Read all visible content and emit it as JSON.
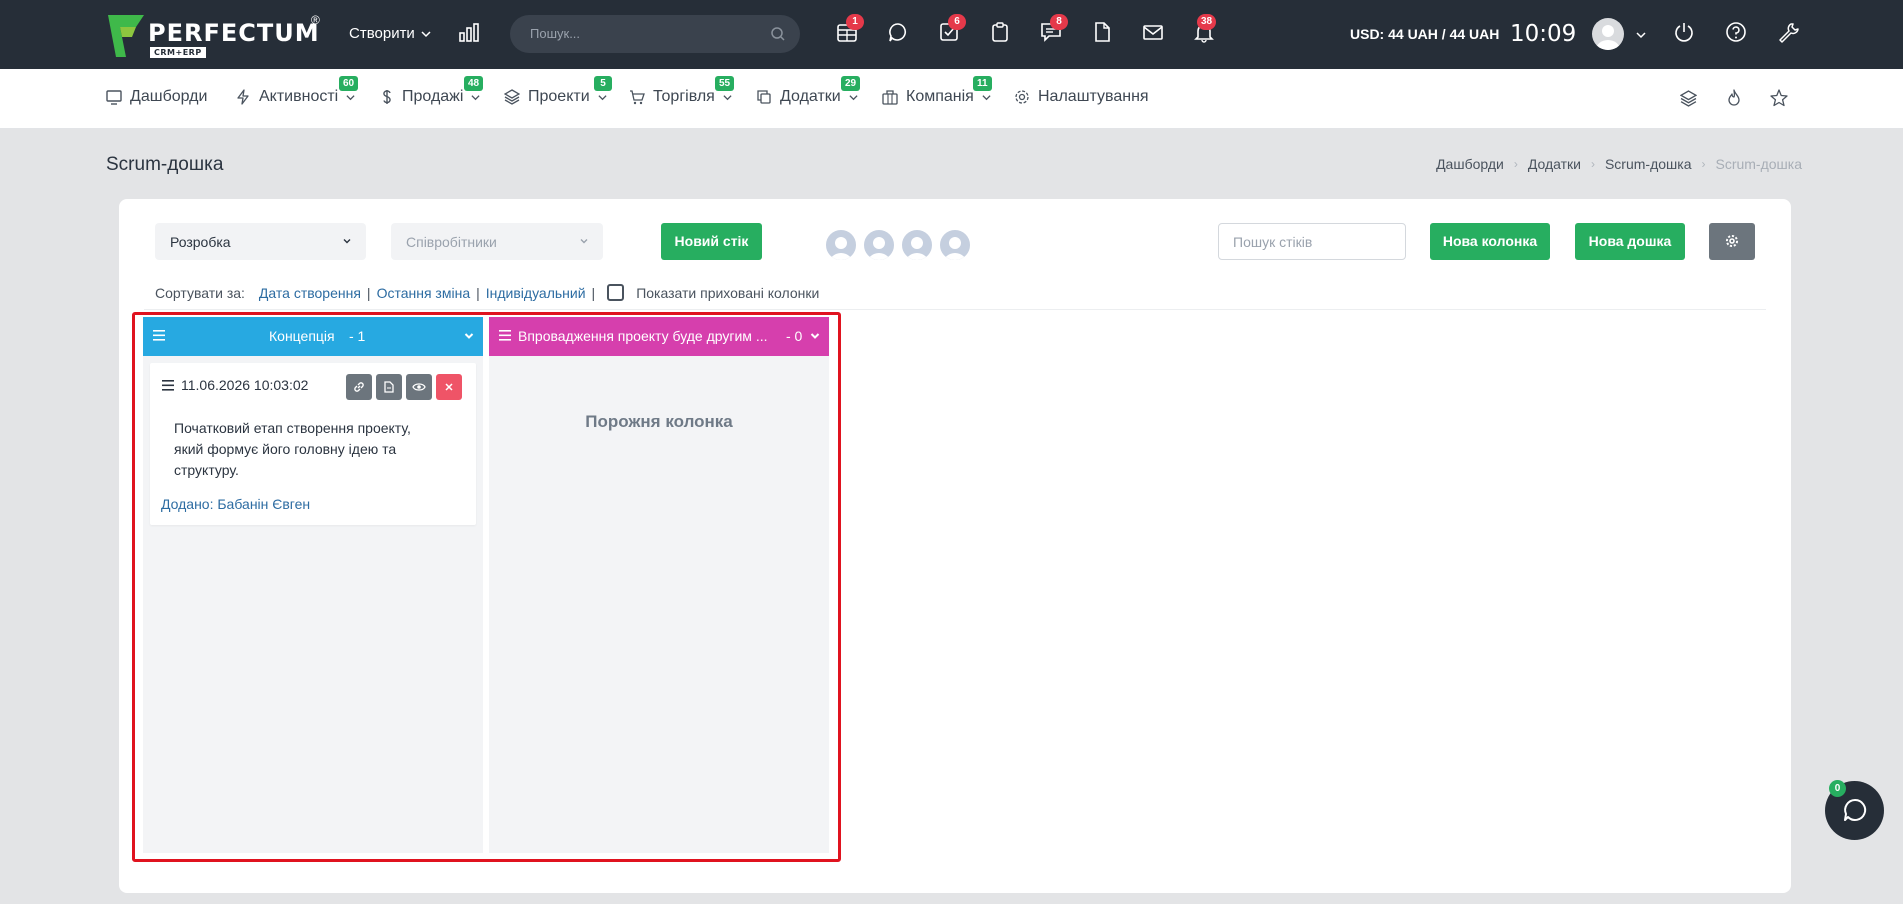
{
  "topbar": {
    "logo_text": "PERFECTUM",
    "logo_sub": "CRM+ERP",
    "logo_reg": "®",
    "create_label": "Створити",
    "search_placeholder": "Пошук...",
    "badges": {
      "calendar": "1",
      "tasks": "6",
      "chat": "8",
      "notifications": "38"
    },
    "currency": "USD: 44 UAH / 44 UAH",
    "time": "10:09"
  },
  "nav": {
    "items": [
      {
        "label": "Дашборди",
        "icon": "monitor-icon",
        "badge": ""
      },
      {
        "label": "Активності",
        "icon": "bolt-icon",
        "badge": "60"
      },
      {
        "label": "Продажі",
        "icon": "dollar-icon",
        "badge": "48"
      },
      {
        "label": "Проекти",
        "icon": "layers-icon",
        "badge": "5"
      },
      {
        "label": "Торгівля",
        "icon": "cart-icon",
        "badge": "55"
      },
      {
        "label": "Додатки",
        "icon": "copy-icon",
        "badge": "29"
      },
      {
        "label": "Компанія",
        "icon": "briefcase-icon",
        "badge": "11"
      },
      {
        "label": "Налаштування",
        "icon": "gear-icon",
        "badge": ""
      }
    ]
  },
  "page": {
    "title": "Scrum-дошка",
    "breadcrumb": [
      "Дашборди",
      "Додатки",
      "Scrum-дошка",
      "Scrum-дошка"
    ]
  },
  "toolbar": {
    "board_select": "Розробка",
    "employees_placeholder": "Співробітники",
    "new_sticker": "Новий стік",
    "search_placeholder": "Пошук стіків",
    "new_column": "Нова колонка",
    "new_board": "Нова дошка"
  },
  "sort": {
    "label": "Сортувати за:",
    "options": [
      "Дата створення",
      "Остання зміна",
      "Індивідуальний"
    ],
    "show_hidden": "Показати приховані колонки"
  },
  "columns": [
    {
      "title": "Концепція",
      "count": "- 1",
      "color": "#27a9e1",
      "stickers": [
        {
          "date": "11.06.2026 10:03:02",
          "text": "Початковий етап створення проекту, який формує його головну ідею та структуру.",
          "added_by": "Додано: Бабанін Євген"
        }
      ]
    },
    {
      "title": "Впровадження проекту буде другим ...",
      "count": "- 0",
      "color": "#d63fad",
      "empty_label": "Порожня колонка"
    }
  ],
  "chat": {
    "badge": "0"
  }
}
